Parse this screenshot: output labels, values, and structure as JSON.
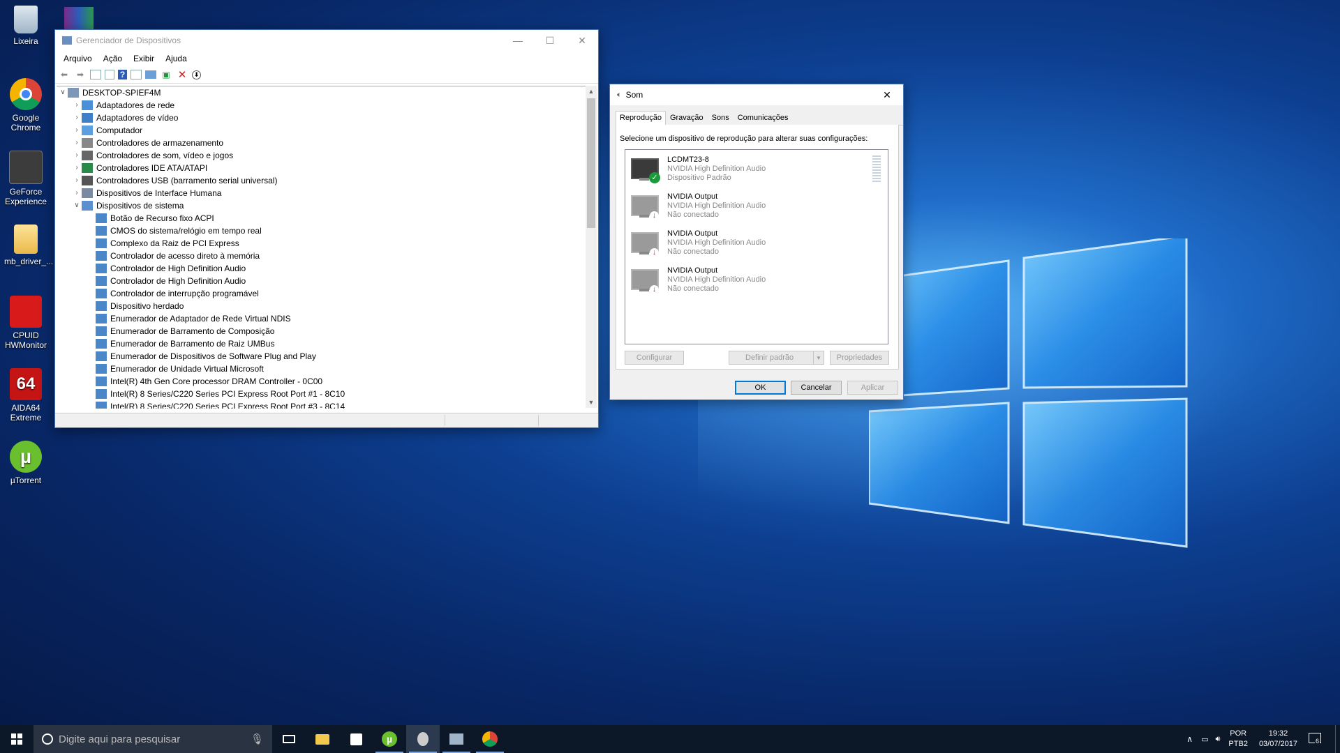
{
  "desktop": {
    "icons": [
      {
        "label": "Lixeira",
        "icon": "recycle-bin-icon"
      },
      {
        "label": "Google Chrome",
        "icon": "chrome-icon"
      },
      {
        "label": "GeForce Experience",
        "icon": "geforce-icon"
      },
      {
        "label": "mb_driver_...",
        "icon": "folder-icon"
      },
      {
        "label": "CPUID HWMonitor",
        "icon": "hwmonitor-icon"
      },
      {
        "label": "AIDA64 Extreme",
        "icon": "aida64-icon"
      },
      {
        "label": "µTorrent",
        "icon": "utorrent-icon"
      }
    ]
  },
  "devmgr": {
    "title": "Gerenciador de Dispositivos",
    "menu": [
      "Arquivo",
      "Ação",
      "Exibir",
      "Ajuda"
    ],
    "root": "DESKTOP-SPIEF4M",
    "categories": [
      "Adaptadores de rede",
      "Adaptadores de vídeo",
      "Computador",
      "Controladores de armazenamento",
      "Controladores de som, vídeo e jogos",
      "Controladores IDE ATA/ATAPI",
      "Controladores USB (barramento serial universal)",
      "Dispositivos de Interface Humana",
      "Dispositivos de sistema"
    ],
    "system_devices": [
      "Botão de Recurso fixo ACPI",
      "CMOS do sistema/relógio em tempo real",
      "Complexo da Raiz de PCI Express",
      "Controlador de acesso direto à memória",
      "Controlador de High Definition Audio",
      "Controlador de High Definition Audio",
      "Controlador de interrupção programável",
      "Dispositivo herdado",
      "Enumerador de Adaptador de Rede Virtual NDIS",
      "Enumerador de Barramento de Composição",
      "Enumerador de Barramento de Raiz UMBus",
      "Enumerador de Dispositivos de Software Plug and Play",
      "Enumerador de Unidade Virtual Microsoft",
      "Intel(R) 4th Gen Core processor DRAM Controller - 0C00",
      "Intel(R) 8 Series/C220 Series PCI Express Root Port #1 - 8C10",
      "Intel(R) 8 Series/C220 Series PCI Express Root Port #3 - 8C14"
    ]
  },
  "sound": {
    "title": "Som",
    "tabs": [
      "Reprodução",
      "Gravação",
      "Sons",
      "Comunicações"
    ],
    "instruction": "Selecione um dispositivo de reprodução para alterar suas configurações:",
    "devices": [
      {
        "name": "LCDMT23-8",
        "driver": "NVIDIA High Definition Audio",
        "status": "Dispositivo Padrão",
        "state": "default"
      },
      {
        "name": "NVIDIA Output",
        "driver": "NVIDIA High Definition Audio",
        "status": "Não conectado",
        "state": "disconnected"
      },
      {
        "name": "NVIDIA Output",
        "driver": "NVIDIA High Definition Audio",
        "status": "Não conectado",
        "state": "disconnected"
      },
      {
        "name": "NVIDIA Output",
        "driver": "NVIDIA High Definition Audio",
        "status": "Não conectado",
        "state": "disconnected"
      }
    ],
    "buttons": {
      "configure": "Configurar",
      "set_default": "Definir padrão",
      "properties": "Propriedades",
      "ok": "OK",
      "cancel": "Cancelar",
      "apply": "Aplicar"
    }
  },
  "taskbar": {
    "search_placeholder": "Digite aqui para pesquisar",
    "language": "POR",
    "keyboard": "PTB2",
    "time": "19:32",
    "date": "03/07/2017",
    "notifications": "6"
  }
}
